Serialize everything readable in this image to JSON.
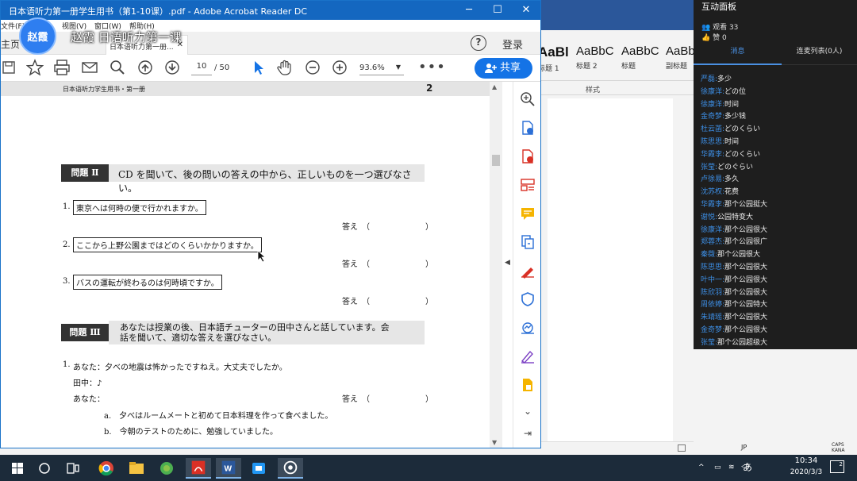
{
  "acrobat": {
    "title": "日本语听力第一册学生用书（第1-10课）.pdf - Adobe Acrobat Reader DC",
    "menu": [
      "文件(F)",
      "视图(V)",
      "窗口(W)",
      "帮助(H)"
    ],
    "home_tab": "主页",
    "doc_tab": "日本语听力第一册...",
    "help_label": "?",
    "login_label": "登录",
    "page_current": "10",
    "page_total": "/ 50",
    "zoom": "93.6%",
    "share_label": "共享"
  },
  "document": {
    "header_left": "日本语听力学生用书・第一册",
    "header_page": "2",
    "section2": {
      "label": "問題 Ⅱ",
      "instruction": "CD を聞いて、後の問いの答えの中から、正しいものを一つ選びなさい。"
    },
    "questions": [
      {
        "num": "1.",
        "text": "東京へは何時の便で行かれますか。"
      },
      {
        "num": "2.",
        "text": "ここから上野公園まではどのくらいかかりますか。"
      },
      {
        "num": "3.",
        "text": "バスの運転が終わるのは何時頃ですか。"
      }
    ],
    "answer_label": "答え　（　　　　　　　）",
    "section3": {
      "label": "問題 Ⅲ",
      "instruction_line1": "あなたは授業の後、日本語チューターの田中さんと話しています。会",
      "instruction_line2": "話を聞いて、適切な答えを選びなさい。"
    },
    "dialogue": {
      "num": "1.",
      "line1": "あなた：夕べの地震は怖かったですねえ。大丈夫でしたか。",
      "line2": "田中：♪",
      "line3": "あなた：",
      "choice_a": "a.　夕べはルームメートと初めて日本料理を作って食べました。",
      "choice_b": "b.　今朝のテストのために、勉強していました。"
    }
  },
  "overlay": {
    "avatar_text": "赵霞",
    "lesson_title": "赵霞 日语听力第一课"
  },
  "word": {
    "styles": [
      {
        "sample": "AaBl",
        "name": "标题 1"
      },
      {
        "sample": "AaBbC",
        "name": "标题 2"
      },
      {
        "sample": "AaBbC",
        "name": "标题"
      },
      {
        "sample": "AaBb",
        "name": "副标题"
      }
    ],
    "group_label": "样式"
  },
  "chat": {
    "header": "互动面板",
    "viewers": "观看 33",
    "likes": "赞 0",
    "tab_messages": "消息",
    "tab_linkmic": "连麦列表(0人)",
    "messages": [
      {
        "name": "严磊:",
        "text": "多少"
      },
      {
        "name": "徐康洋:",
        "text": "どの位"
      },
      {
        "name": "徐康洋:",
        "text": "时间"
      },
      {
        "name": "金奇梦:",
        "text": "多少钱"
      },
      {
        "name": "杜云菡:",
        "text": "どのくらい"
      },
      {
        "name": "陈思思:",
        "text": "时间"
      },
      {
        "name": "华霞李:",
        "text": "どのくらい"
      },
      {
        "name": "张莹:",
        "text": "どのぐらい"
      },
      {
        "name": "卢徐易:",
        "text": "多久"
      },
      {
        "name": "沈苏权:",
        "text": "花费"
      },
      {
        "name": "华霞李:",
        "text": "那个公园挺大"
      },
      {
        "name": "谢悦:",
        "text": "公园特变大"
      },
      {
        "name": "徐康洋:",
        "text": "那个公园很大"
      },
      {
        "name": "郑蓉杰:",
        "text": "那个公园很广"
      },
      {
        "name": "秦薇:",
        "text": "那个公园很大"
      },
      {
        "name": "陈思思:",
        "text": "那个公园很大"
      },
      {
        "name": "叶中一:",
        "text": "那个公园很大"
      },
      {
        "name": "陈欣羽:",
        "text": "那个公园很大"
      },
      {
        "name": "周依婷:",
        "text": "那个公园特大"
      },
      {
        "name": "朱靖瑶:",
        "text": "那个公园很大"
      },
      {
        "name": "金奇梦:",
        "text": "那个公园很大"
      },
      {
        "name": "张莹:",
        "text": "那个公园超级大"
      }
    ]
  },
  "taskbar": {
    "ime_label": "あ",
    "time": "10:34",
    "date": "2020/3/3",
    "notification_count": "2",
    "tray_lang": "JP",
    "tray_caps": "CAPS KANA"
  },
  "colors": {
    "acrobat_blue": "#1467c0",
    "share_blue": "#1473e6",
    "chat_name_blue": "#3d8fe6",
    "word_blue": "#2b579a",
    "taskbar": "#1c2b3a"
  }
}
